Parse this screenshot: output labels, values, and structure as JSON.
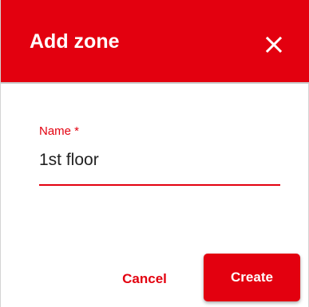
{
  "dialog": {
    "title": "Add zone",
    "close_icon": "close-icon"
  },
  "form": {
    "name_label": "Name *",
    "name_value": "1st floor"
  },
  "actions": {
    "cancel_label": "Cancel",
    "create_label": "Create"
  },
  "colors": {
    "accent": "#e3000f",
    "header_text": "#ffffff",
    "input_text": "#222222"
  }
}
